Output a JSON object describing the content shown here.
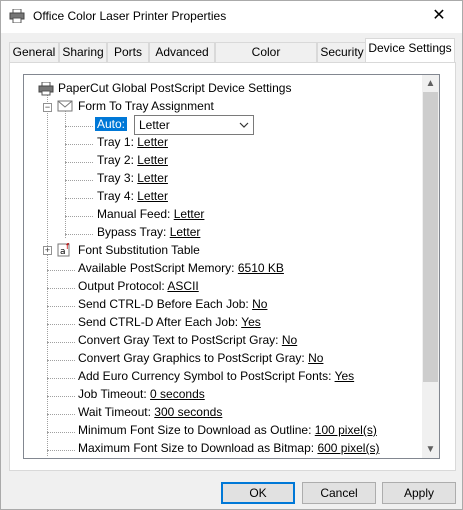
{
  "window": {
    "title": "Office Color Laser Printer Properties",
    "close_label": "✕"
  },
  "tabs": [
    "General",
    "Sharing",
    "Ports",
    "Advanced",
    "Color Management",
    "Security",
    "Device Settings"
  ],
  "tree": {
    "root": "PaperCut Global PostScript Device Settings",
    "form_to_tray": "Form To Tray Assignment",
    "auto_label": "Auto:",
    "auto_value": "Letter",
    "trays": [
      {
        "label": "Tray 1:",
        "value": "Letter"
      },
      {
        "label": "Tray 2:",
        "value": "Letter"
      },
      {
        "label": "Tray 3:",
        "value": "Letter"
      },
      {
        "label": "Tray 4:",
        "value": "Letter"
      },
      {
        "label": "Manual Feed:",
        "value": "Letter"
      },
      {
        "label": "Bypass Tray:",
        "value": "Letter"
      }
    ],
    "font_sub": "Font Substitution Table",
    "settings": [
      {
        "label": "Available PostScript Memory:",
        "value": "6510 KB"
      },
      {
        "label": "Output Protocol:",
        "value": "ASCII"
      },
      {
        "label": "Send CTRL-D Before Each Job:",
        "value": "No"
      },
      {
        "label": "Send CTRL-D After Each Job:",
        "value": "Yes"
      },
      {
        "label": "Convert Gray Text to PostScript Gray:",
        "value": "No"
      },
      {
        "label": "Convert Gray Graphics to PostScript Gray:",
        "value": "No"
      },
      {
        "label": "Add Euro Currency Symbol to PostScript Fonts:",
        "value": "Yes"
      },
      {
        "label": "Job Timeout:",
        "value": "0 seconds"
      },
      {
        "label": "Wait Timeout:",
        "value": "300 seconds"
      },
      {
        "label": "Minimum Font Size to Download as Outline:",
        "value": "100 pixel(s)"
      },
      {
        "label": "Maximum Font Size to Download as Bitmap:",
        "value": "600 pixel(s)"
      }
    ]
  },
  "buttons": {
    "ok": "OK",
    "cancel": "Cancel",
    "apply": "Apply"
  },
  "colors": {
    "accent": "#0078d7",
    "panel_bg": "#f0f0f0"
  }
}
